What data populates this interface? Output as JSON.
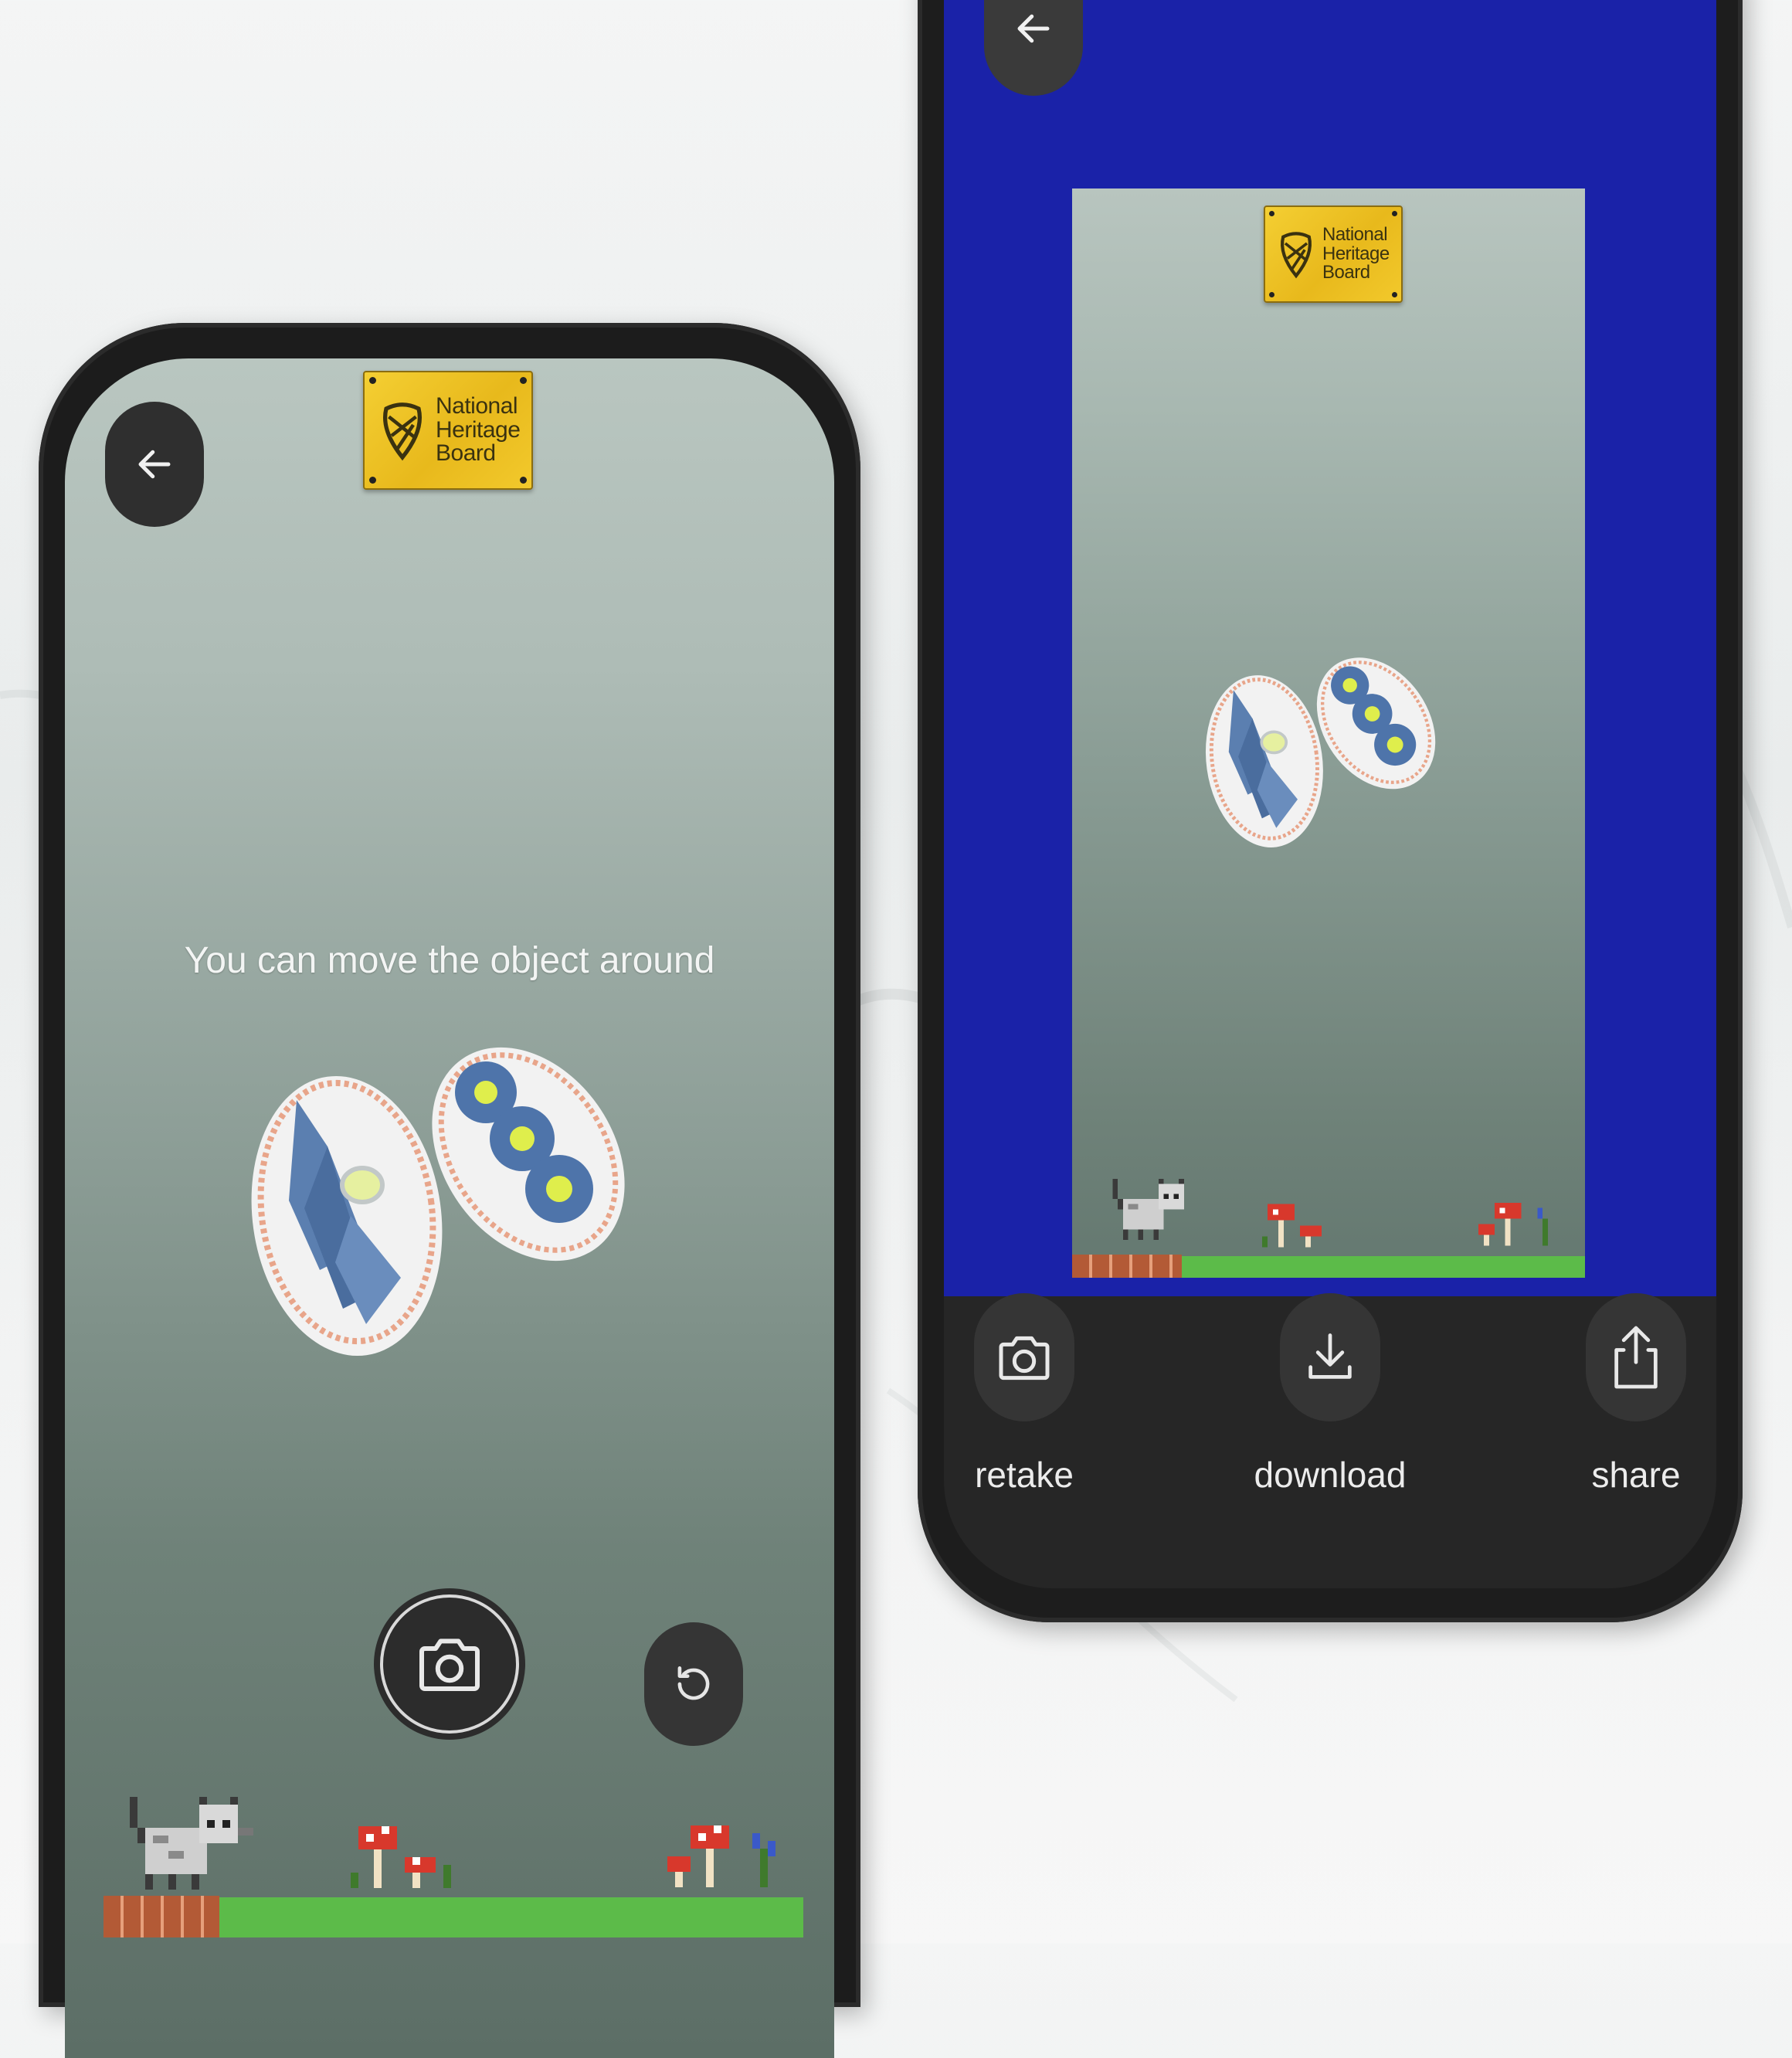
{
  "left_screen": {
    "back_icon": "arrow-left-icon",
    "logo_lines": [
      "National",
      "Heritage",
      "Board"
    ],
    "hint_text": "You can move the object around",
    "capture_icon": "camera-icon",
    "reset_icon": "rotate-ccw-icon"
  },
  "right_screen": {
    "back_icon": "arrow-left-icon",
    "logo_lines": [
      "National",
      "Heritage",
      "Board"
    ],
    "actions": [
      {
        "label": "retake",
        "icon": "camera-icon"
      },
      {
        "label": "download",
        "icon": "download-icon"
      },
      {
        "label": "share",
        "icon": "share-icon"
      }
    ]
  },
  "colors": {
    "preview_background": "#1a22a8",
    "action_bar": "#262626",
    "logo_gold": "#f2c92c"
  }
}
